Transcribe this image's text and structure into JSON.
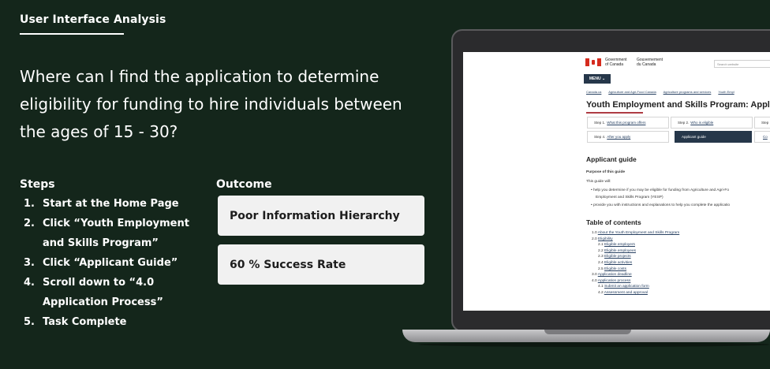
{
  "header": {
    "title": "User Interface Analysis"
  },
  "question": "Where can I find the application to determine eligibility for funding to hire individuals between the ages of 15 - 30?",
  "steps": {
    "heading": "Steps",
    "items": [
      {
        "num": "1.",
        "text": "Start at the Home Page"
      },
      {
        "num": "2.",
        "text": "Click “Youth Employment and Skills Program”"
      },
      {
        "num": "3.",
        "text": "Click “Applicant Guide”"
      },
      {
        "num": "4.",
        "text": "Scroll down to “4.0 Application Process”"
      },
      {
        "num": "5.",
        "text": "Task Complete"
      }
    ]
  },
  "outcome": {
    "heading": "Outcome",
    "items": [
      "Poor Information Hierarchy",
      "60 % Success Rate"
    ]
  },
  "colors": {
    "background": "#14261b",
    "accent_rule": "#af3c43",
    "gov_nav": "#26374a"
  },
  "screen": {
    "gov_en": [
      "Government",
      "of Canada"
    ],
    "gov_fr": [
      "Gouvernement",
      "du Canada"
    ],
    "search_placeholder": "Search website",
    "menu_label": "MENU ⌄",
    "breadcrumbs": [
      "Canada.ca",
      "Agriculture and Agri-Food Canada",
      "Agriculture programs and services",
      "Youth Empl"
    ],
    "page_title": "Youth Employment and Skills Program: Applicant",
    "steps": [
      {
        "prefix": "Step 1.",
        "link": "What this program offers"
      },
      {
        "prefix": "Step 2.",
        "link": "Who is eligible"
      },
      {
        "prefix": "Step",
        "link": ""
      },
      {
        "prefix": "Step 4.",
        "link": "After you apply"
      },
      {
        "prefix": "Applicant guide",
        "link": ""
      },
      {
        "prefix": "",
        "link": "Co"
      }
    ],
    "section_heading": "Applicant guide",
    "purpose_heading": "Purpose of this guide",
    "purpose_intro": "This guide will:",
    "bullets": [
      "help you determine if you may be eligible for funding from Agriculture and Agri-Fo",
      "Employment and Skills Program (YESP)",
      "provide you with instructions and explanations to help you complete the applicatio"
    ],
    "toc_heading": "Table of contents",
    "toc": [
      {
        "num": "1.0",
        "text": "About the Youth Employment and Skills Program",
        "sub": false
      },
      {
        "num": "2.0",
        "text": "Eligibility",
        "sub": false
      },
      {
        "num": "2.1",
        "text": "Eligible employers",
        "sub": true
      },
      {
        "num": "2.2",
        "text": "Eligible employees",
        "sub": true
      },
      {
        "num": "2.3",
        "text": "Eligible projects",
        "sub": true
      },
      {
        "num": "2.4",
        "text": "Eligible activities",
        "sub": true
      },
      {
        "num": "2.5",
        "text": "Eligible costs",
        "sub": true
      },
      {
        "num": "3.0",
        "text": "Application deadline",
        "sub": false
      },
      {
        "num": "4.0",
        "text": "Application process",
        "sub": false
      },
      {
        "num": "4.1",
        "text": "Submit an application form",
        "sub": true
      },
      {
        "num": "4.2",
        "text": "Assessment and approval",
        "sub": true
      }
    ]
  }
}
